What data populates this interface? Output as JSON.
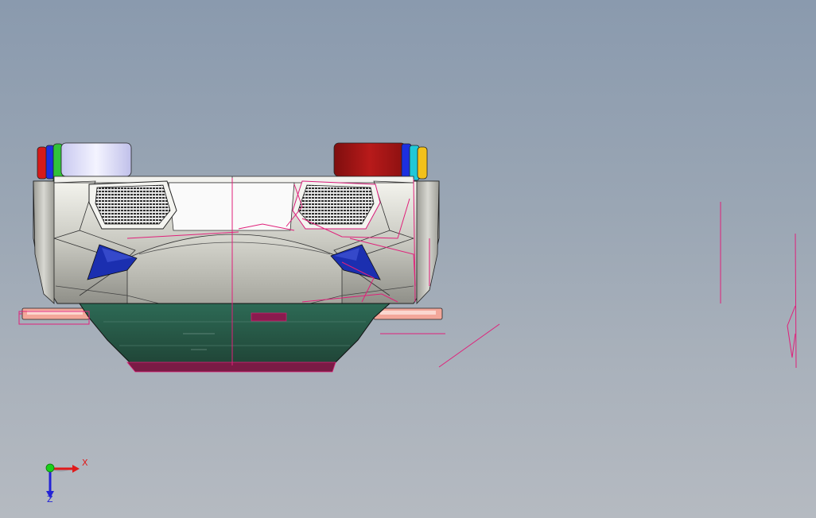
{
  "viewport": {
    "background_top": "#8a9aae",
    "background_bottom": "#b5bac1"
  },
  "model": {
    "colors": {
      "body_light": "#e6e6e0",
      "body_mid": "#bcbcb4",
      "body_dark": "#8e8e88",
      "underside_green": "#2e5b4a",
      "sketch_magenta": "#e0207a",
      "grille": "#3a3a3a",
      "blue_panel": "#1b2fb0",
      "tab_red": "#a41515",
      "tab_lavender": "#d8d8f4",
      "tab_green": "#31c23a",
      "tab_blue": "#1c2fe0",
      "tab_cyan": "#21c8d8",
      "tab_yellow": "#f2c11a",
      "tab_salmon": "#f3a79a"
    }
  },
  "triad": {
    "x_label": "X",
    "z_label": "Z",
    "x_color": "#e01a1a",
    "y_color": "#19d119",
    "z_color": "#2323d6"
  }
}
